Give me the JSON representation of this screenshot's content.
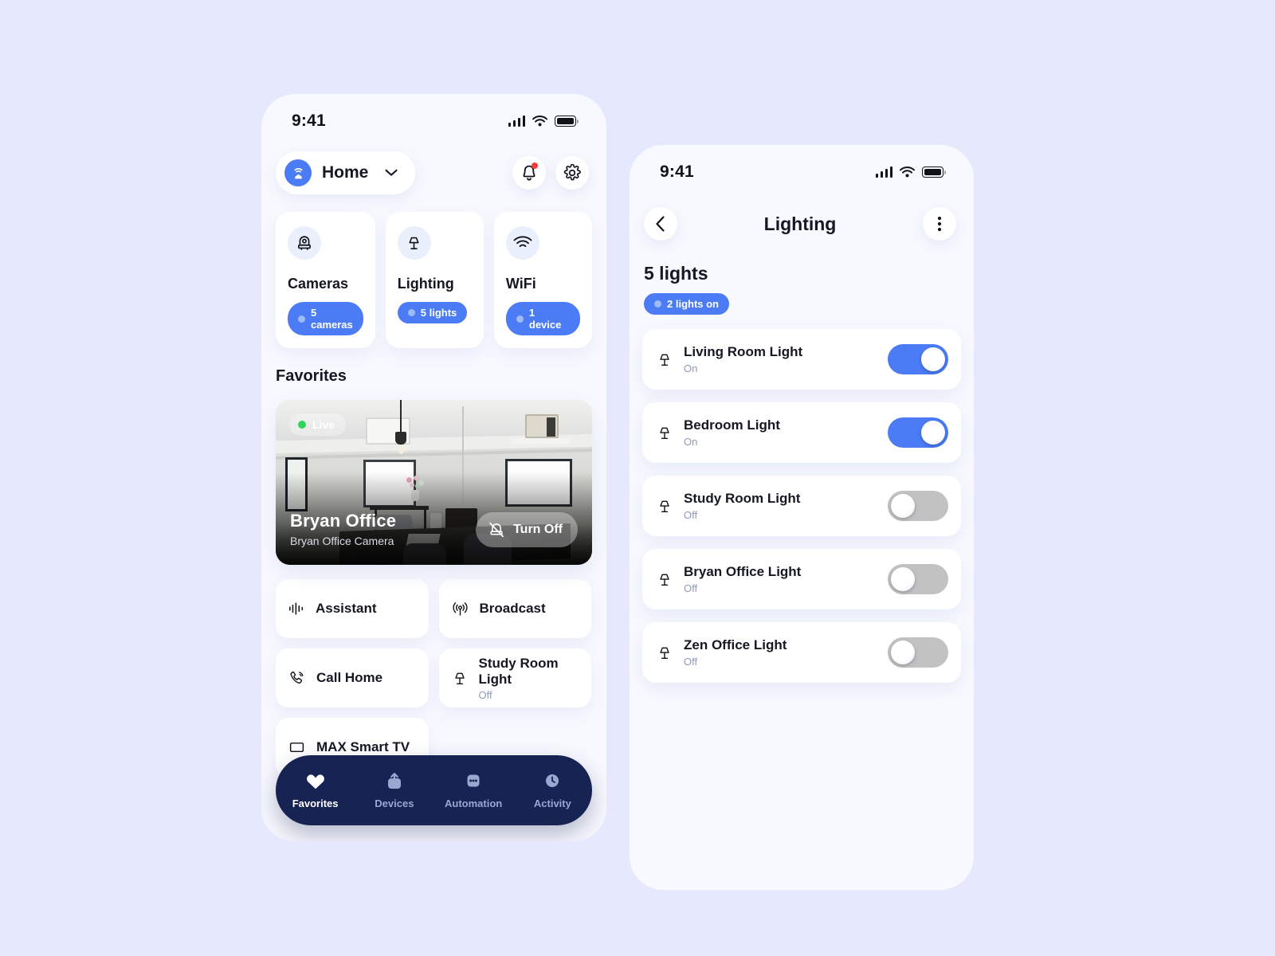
{
  "background_color": "#e6e9fd",
  "accent_color": "#4b7bf5",
  "nav_color": "#172352",
  "phone_left": {
    "status": {
      "time": "9:41",
      "signal_icon": "cellular-signal-icon",
      "wifi_icon": "wifi-icon",
      "battery_icon": "battery-full-icon"
    },
    "home_selector": {
      "label": "Home",
      "icon": "home-hub-icon",
      "chevron": "chevron-down-icon"
    },
    "actions": {
      "notifications": "bell-icon",
      "settings": "gear-icon"
    },
    "categories": [
      {
        "title": "Cameras",
        "badge": "5 cameras",
        "icon": "security-camera-icon"
      },
      {
        "title": "Lighting",
        "badge": "5 lights",
        "icon": "table-lamp-icon"
      },
      {
        "title": "WiFi",
        "badge": "1 device",
        "icon": "wifi-icon"
      }
    ],
    "favorites_heading": "Favorites",
    "camera_card": {
      "live_label": "Live",
      "name": "Bryan Office",
      "subtitle": "Bryan Office Camera",
      "button_label": "Turn Off",
      "button_icon": "camera-off-icon"
    },
    "tiles": [
      {
        "label": "Assistant",
        "sub": "",
        "icon": "voice-waveform-icon"
      },
      {
        "label": "Broadcast",
        "sub": "",
        "icon": "broadcast-icon"
      },
      {
        "label": "Call Home",
        "sub": "",
        "icon": "phone-call-icon"
      },
      {
        "label": "Study Room Light",
        "sub": "Off",
        "icon": "table-lamp-icon"
      },
      {
        "label": "MAX Smart TV",
        "sub": "",
        "icon": "tv-icon"
      }
    ],
    "nav": [
      {
        "label": "Favorites",
        "icon": "heart-icon",
        "active": true
      },
      {
        "label": "Devices",
        "icon": "upload-device-icon",
        "active": false
      },
      {
        "label": "Automation",
        "icon": "dots-square-icon",
        "active": false
      },
      {
        "label": "Activity",
        "icon": "clock-icon",
        "active": false
      }
    ]
  },
  "phone_right": {
    "status": {
      "time": "9:41",
      "signal_icon": "cellular-signal-icon",
      "wifi_icon": "wifi-icon",
      "battery_icon": "battery-full-icon"
    },
    "header": {
      "back_icon": "chevron-left-icon",
      "title": "Lighting",
      "menu_icon": "more-vertical-icon"
    },
    "count_label": "5 lights",
    "on_badge": "2 lights on",
    "lights": [
      {
        "name": "Living Room Light",
        "state": "On",
        "on": true,
        "icon": "table-lamp-icon"
      },
      {
        "name": "Bedroom Light",
        "state": "On",
        "on": true,
        "icon": "table-lamp-icon"
      },
      {
        "name": "Study Room Light",
        "state": "Off",
        "on": false,
        "icon": "table-lamp-icon"
      },
      {
        "name": "Bryan Office Light",
        "state": "Off",
        "on": false,
        "icon": "table-lamp-icon"
      },
      {
        "name": "Zen Office Light",
        "state": "Off",
        "on": false,
        "icon": "table-lamp-icon"
      }
    ]
  }
}
